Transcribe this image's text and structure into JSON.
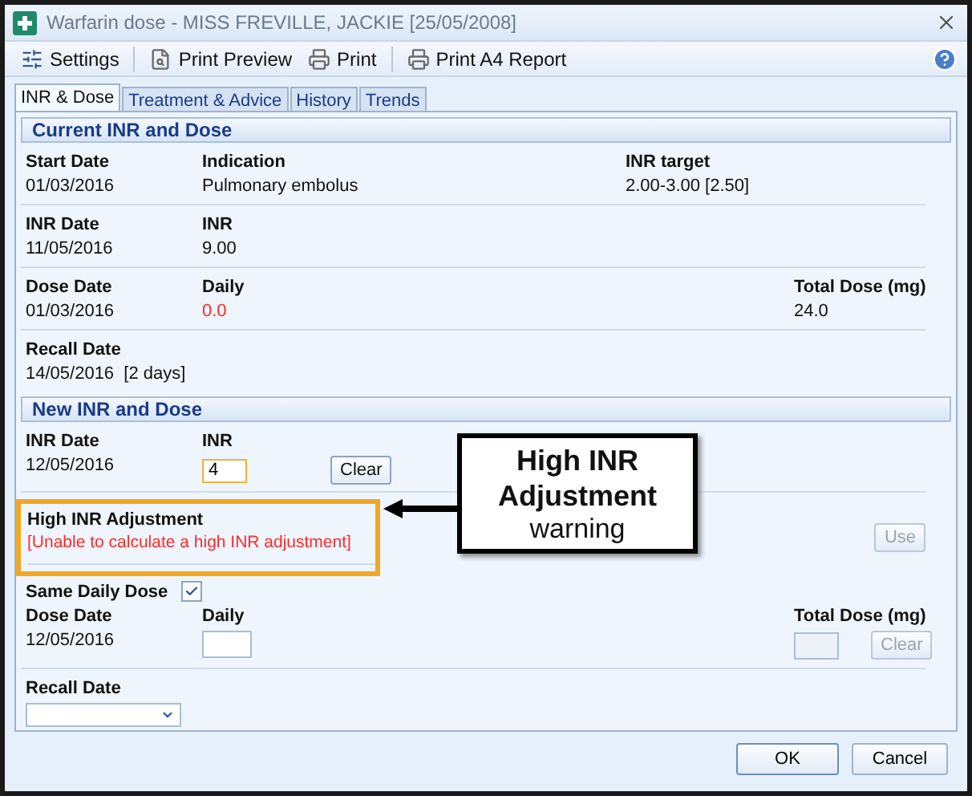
{
  "window": {
    "title": "Warfarin dose - MISS FREVILLE, JACKIE [25/05/2008]"
  },
  "toolbar": [
    {
      "label": "Settings",
      "kind": "settings"
    },
    {
      "label": "Print Preview",
      "kind": "preview"
    },
    {
      "label": "Print",
      "kind": "print"
    },
    {
      "label": "Print A4 Report",
      "kind": "print"
    }
  ],
  "tabs": [
    {
      "label": "INR & Dose",
      "selected": true
    },
    {
      "label": "Treatment & Advice",
      "selected": false
    },
    {
      "label": "History",
      "selected": false
    },
    {
      "label": "Trends",
      "selected": false
    }
  ],
  "current": {
    "title": "Current INR and Dose",
    "start_date": {
      "label": "Start Date",
      "value": "01/03/2016"
    },
    "indication": {
      "label": "Indication",
      "value": "Pulmonary embolus"
    },
    "inr_target": {
      "label": "INR target",
      "value": "2.00-3.00 [2.50]"
    },
    "inr_date": {
      "label": "INR Date",
      "value": "11/05/2016"
    },
    "inr": {
      "label": "INR",
      "value": "9.00"
    },
    "dose_date": {
      "label": "Dose Date",
      "value": "01/03/2016"
    },
    "daily": {
      "label": "Daily",
      "value": "0.0",
      "alert": true
    },
    "total_dose": {
      "label": "Total Dose (mg)",
      "value": "24.0"
    },
    "recall_date": {
      "label": "Recall Date",
      "value": "14/05/2016  [2 days]"
    }
  },
  "new": {
    "title": "New INR and Dose",
    "inr_date": {
      "label": "INR Date",
      "value": "12/05/2016"
    },
    "inr": {
      "label": "INR",
      "value": "4"
    },
    "clear_button": {
      "label": "Clear",
      "disabled": false
    },
    "adjustment": {
      "label": "High INR Adjustment",
      "message": "[Unable to calculate a high INR adjustment]"
    },
    "use_button": {
      "label": "Use",
      "disabled": true
    },
    "same_daily": {
      "label": "Same Daily Dose",
      "checked": true
    },
    "dose_date": {
      "label": "Dose Date",
      "value": "12/05/2016"
    },
    "daily": {
      "label": "Daily"
    },
    "total_dose": {
      "label": "Total Dose (mg)",
      "disabled": true
    },
    "clear_dose_button": {
      "label": "Clear",
      "disabled": true
    },
    "recall_date": {
      "label": "Recall Date"
    }
  },
  "callout": {
    "title": "High INR Adjustment",
    "note": "warning"
  },
  "buttons": [
    {
      "label": "OK",
      "kind": "default"
    },
    {
      "label": "Cancel",
      "kind": "normal"
    }
  ]
}
